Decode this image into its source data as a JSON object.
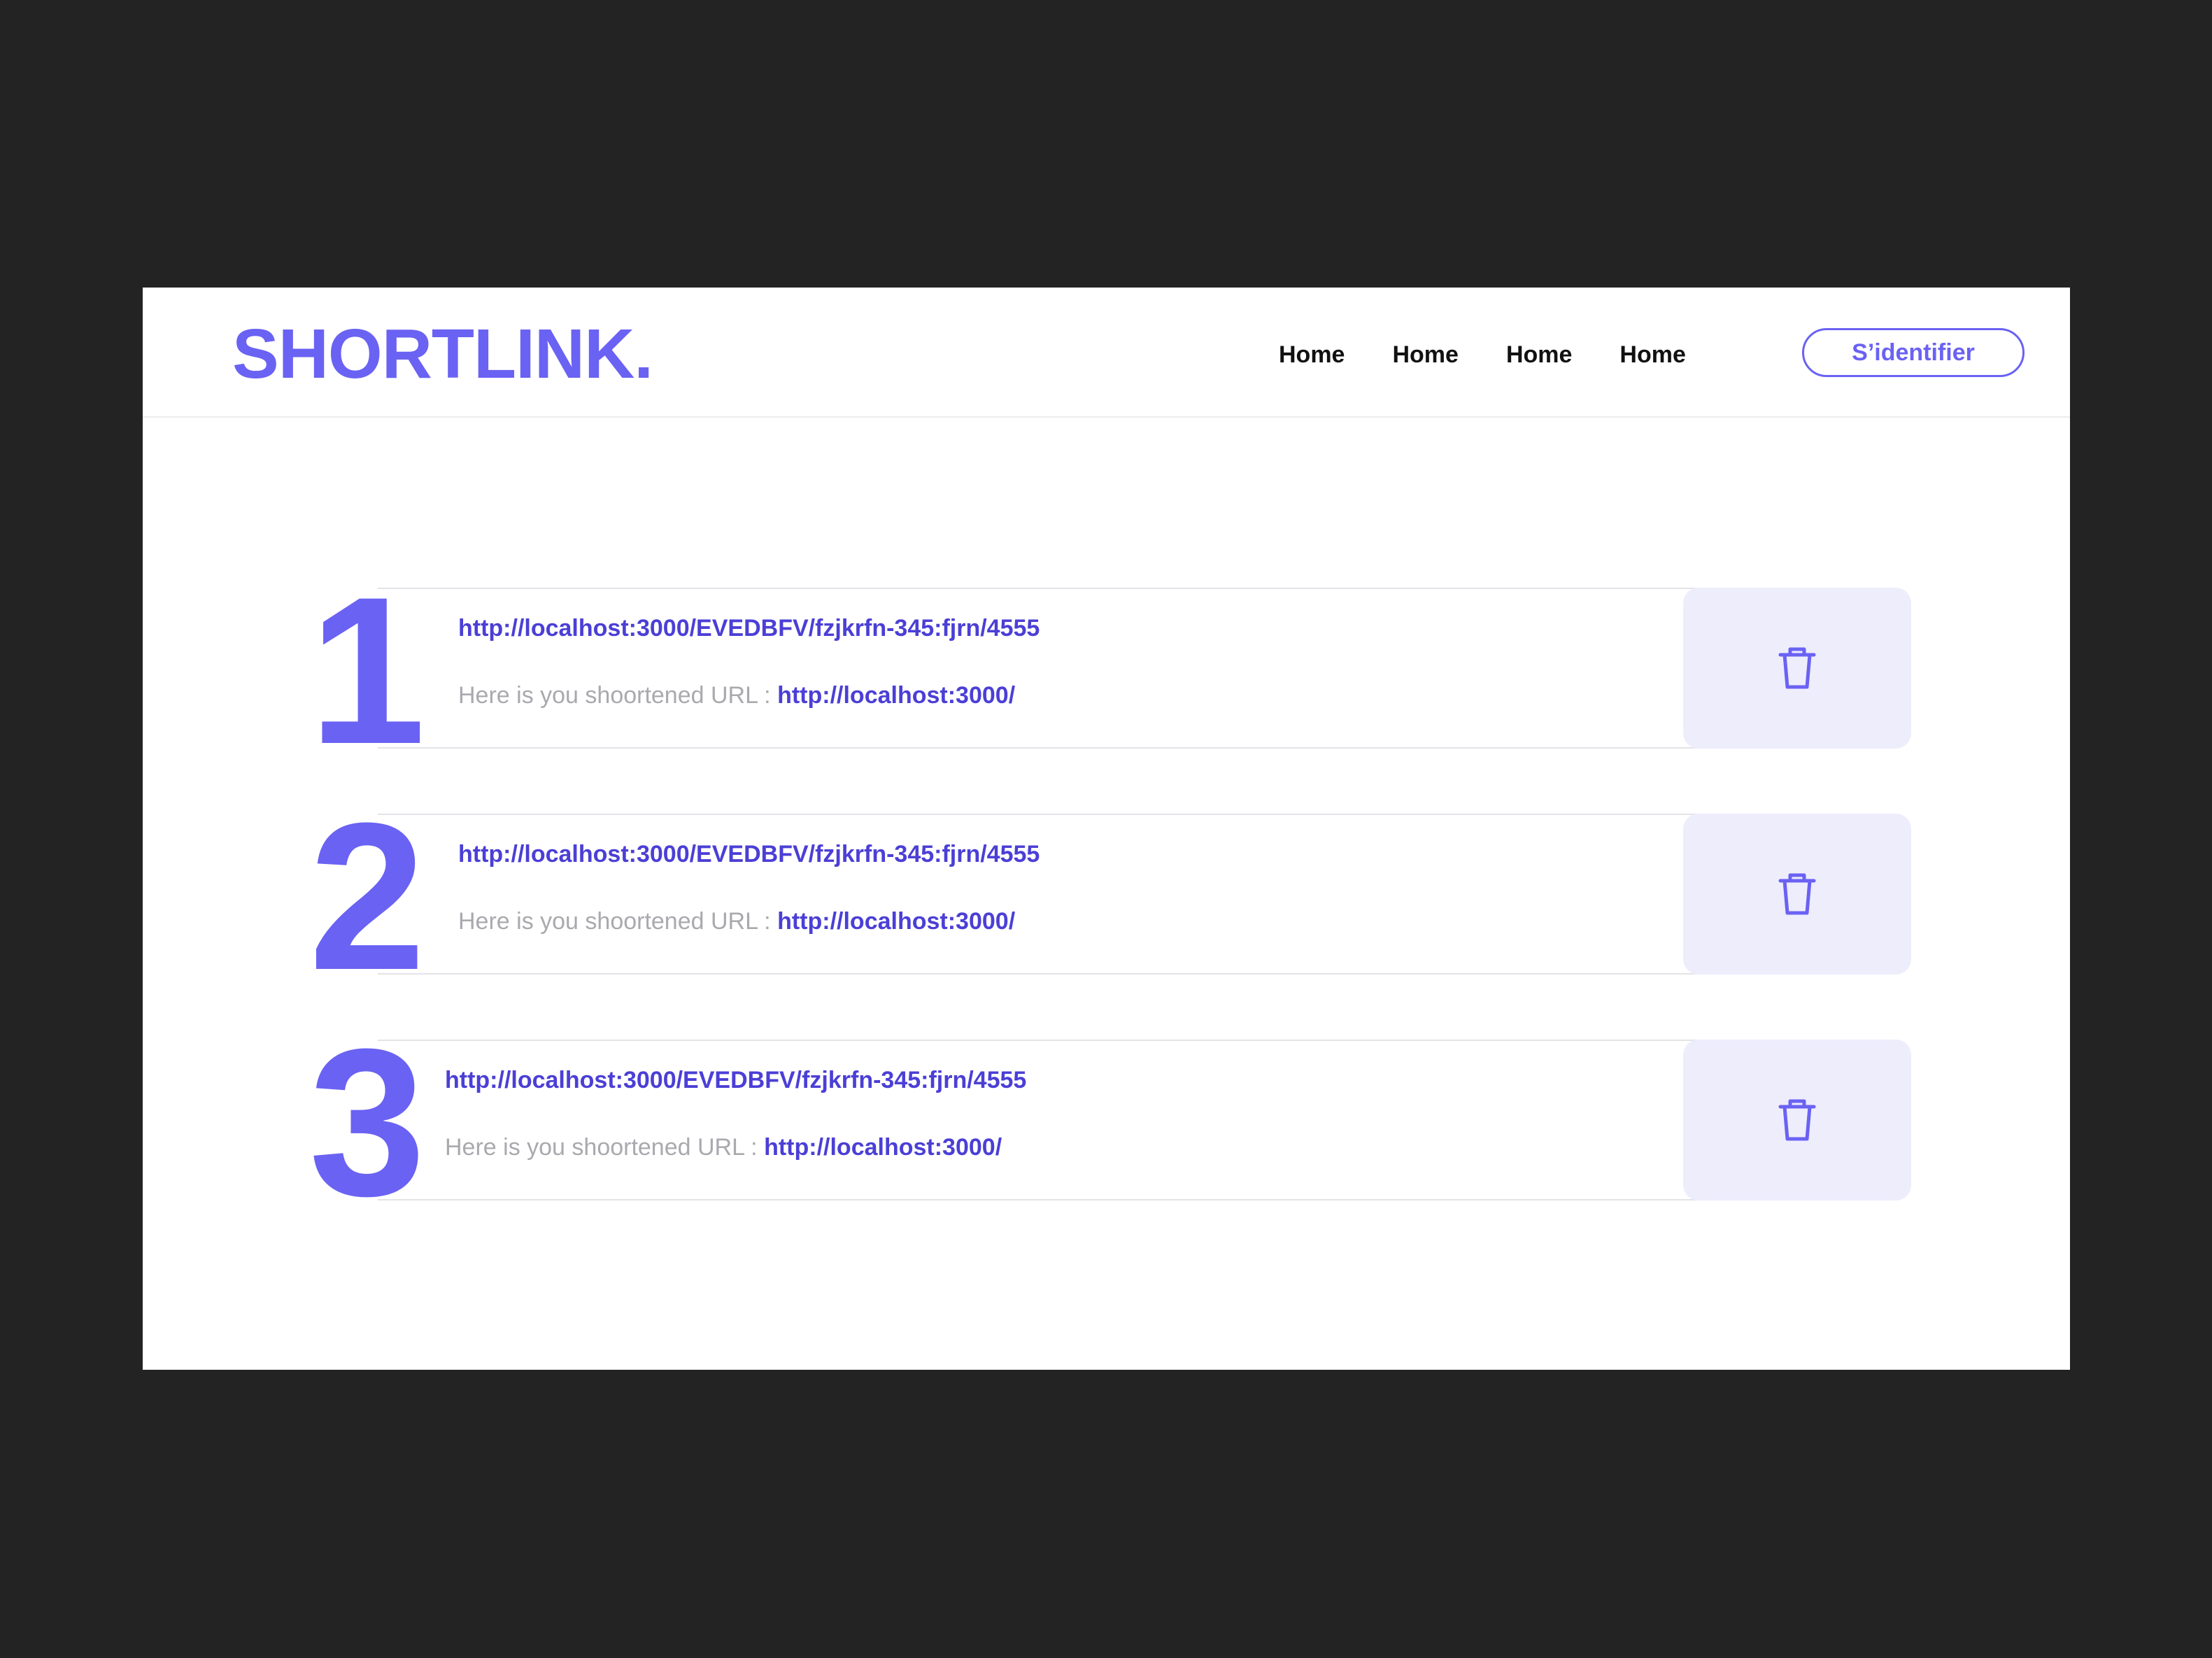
{
  "brand": {
    "logo": "SHORTLINK.",
    "accent_color": "#6a62f3",
    "link_color": "#4b3fd6"
  },
  "nav": {
    "links": [
      "Home",
      "Home",
      "Home",
      "Home"
    ],
    "signin_label": "S’identifier"
  },
  "links": [
    {
      "number": "1",
      "original_url": "http://localhost:3000/EVEDBFV/fzjkrfn-345:fjrn/4555",
      "short_label": "Here is you shoortened URL :",
      "short_url": "http://localhost:3000/",
      "delete_icon": "trash-icon"
    },
    {
      "number": "2",
      "original_url": "http://localhost:3000/EVEDBFV/fzjkrfn-345:fjrn/4555",
      "short_label": "Here is you shoortened URL :",
      "short_url": "http://localhost:3000/",
      "delete_icon": "trash-icon"
    },
    {
      "number": "3",
      "original_url": "http://localhost:3000/EVEDBFV/fzjkrfn-345:fjrn/4555",
      "short_label": "Here is you shoortened URL :",
      "short_url": "http://localhost:3000/",
      "delete_icon": "trash-icon"
    }
  ]
}
